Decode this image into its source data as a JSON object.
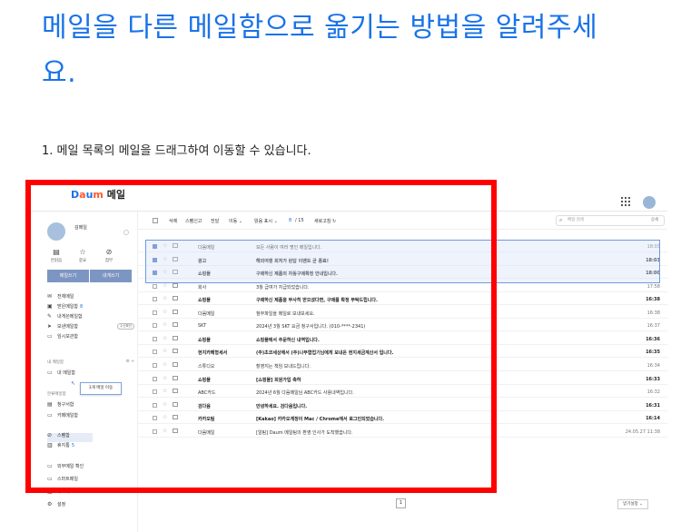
{
  "article": {
    "title": "메일을 다른 메일함으로 옮기는 방법을 알려주세요.",
    "step": "1. 메일 목록의 메일을 드래그하여 이동할 수 있습니다."
  },
  "app": {
    "logo_mark": "Daum",
    "logo_text": "메일"
  },
  "colors": {
    "title": "#1a73e8",
    "highlight_frame": "#ff0000",
    "accent": "#7d95c2"
  },
  "sidebar": {
    "profile_name": "김메일",
    "quick": [
      {
        "icon": "inbox-icon",
        "label": "안읽음"
      },
      {
        "icon": "star-icon",
        "label": "중요"
      },
      {
        "icon": "paperclip-icon",
        "label": "첨부"
      }
    ],
    "write_label": "메일쓰기",
    "self_label": "내게쓰기",
    "folders": [
      {
        "icon": "mail-icon",
        "label": "전체메일",
        "badge": ""
      },
      {
        "icon": "inbox-icon",
        "label": "받은메일함",
        "badge": "8"
      },
      {
        "icon": "self-mail-icon",
        "label": "내게쓴메일함",
        "badge": ""
      },
      {
        "icon": "send-icon",
        "label": "보낸메일함",
        "badge": "",
        "tag": "수신확인"
      },
      {
        "icon": "folder-icon",
        "label": "임시보관함",
        "badge": ""
      }
    ],
    "my_folders_label": "내 메일함",
    "my_folder": "내 메일함",
    "category_label": "분류메일함",
    "category": [
      {
        "icon": "receipt-icon",
        "label": "청구서함"
      },
      {
        "icon": "folder-icon",
        "label": "카페메일함"
      }
    ],
    "extra": [
      {
        "icon": "spam-icon",
        "label": "스팸함"
      },
      {
        "icon": "trash-icon",
        "label": "휴지통",
        "badge": "5"
      },
      {
        "icon": "folder-icon",
        "label": "외부메일 확인"
      },
      {
        "icon": "folder-icon",
        "label": "스마트메일"
      },
      {
        "icon": "contacts-icon",
        "label": "주소록"
      },
      {
        "icon": "gear-icon",
        "label": "설정"
      }
    ],
    "drag_popup": "3개 메일 이동"
  },
  "toolbar": {
    "delete": "삭제",
    "spam": "스팸신고",
    "reply": "전달",
    "move": "이동 ⌄",
    "read_filter": "읽음 표시 ⌄",
    "count": "8",
    "total": "/ 15",
    "refresh": "새로고침 ↻",
    "search_placeholder": "메일 검색",
    "search_option": "상세"
  },
  "emails": [
    {
      "sender": "다음메일",
      "subject": "모든 사람이 여러 명인 메일입니다.",
      "date": "18:03",
      "checked": true,
      "bold": false
    },
    {
      "sender": "광고",
      "subject": "해외여행 회처가 된답 이벤트 곧 종료!",
      "date": "18:03",
      "checked": true,
      "bold": true
    },
    {
      "sender": "쇼핑몰",
      "subject": "구매하신 제품의 자동구매확정 안내입니다.",
      "date": "18:00",
      "checked": true,
      "bold": true
    },
    {
      "sender": "회사",
      "subject": "3월 급여가 지급되었습니다.",
      "date": "17:58",
      "checked": false,
      "bold": false
    },
    {
      "sender": "쇼핑몰",
      "subject": "구매하신 제품을 무사히 받으셨다면, 구매를 확정 부탁드립니다.",
      "date": "16:38",
      "checked": false,
      "bold": true
    },
    {
      "sender": "다음메일",
      "subject": "첨부파일을 메일로 보내보세요.",
      "date": "16:38",
      "checked": false,
      "bold": false
    },
    {
      "sender": "SKT",
      "subject": "2024년 3월 SKT 요금 청구서입니다. (010-****-2341)",
      "date": "16:37",
      "checked": false,
      "bold": false
    },
    {
      "sender": "쇼핑몰",
      "subject": "쇼핑몰에서 주문하신 내역입니다.",
      "date": "16:36",
      "checked": false,
      "bold": true
    },
    {
      "sender": "현지카페형세서",
      "subject": "(주)초코세상에서 (주)나무협업기님에게 보내온 현지세금계산서 입니다.",
      "date": "16:35",
      "checked": false,
      "bold": true
    },
    {
      "sender": "스튜디오",
      "subject": "촬영지는 책임 보내드립니다.",
      "date": "16:34",
      "checked": false,
      "bold": false
    },
    {
      "sender": "쇼핑몰",
      "subject": "[쇼핑몰] 회원가입 축하",
      "date": "16:33",
      "checked": false,
      "bold": true
    },
    {
      "sender": "ABC카드",
      "subject": "2024년 6월 다음메일님 ABC카드 사용내역입니다.",
      "date": "16:32",
      "checked": false,
      "bold": false
    },
    {
      "sender": "검다음",
      "subject": "안녕하세요. 검다음입니다.",
      "date": "16:31",
      "checked": false,
      "bold": true
    },
    {
      "sender": "카카오팀",
      "subject": "[Kakao] 카카오계정이 Mac / Chrome에서 로그인되었습니다.",
      "date": "16:14",
      "checked": false,
      "bold": true
    },
    {
      "sender": "다음메일",
      "subject": "[알림] Daum 메일팀의 환영 인사가 도착했습니다.",
      "date": "24.05.27 11:38",
      "checked": false,
      "bold": false
    }
  ],
  "pager": {
    "page": "1"
  },
  "sort_label": "받기설정 ⌄"
}
